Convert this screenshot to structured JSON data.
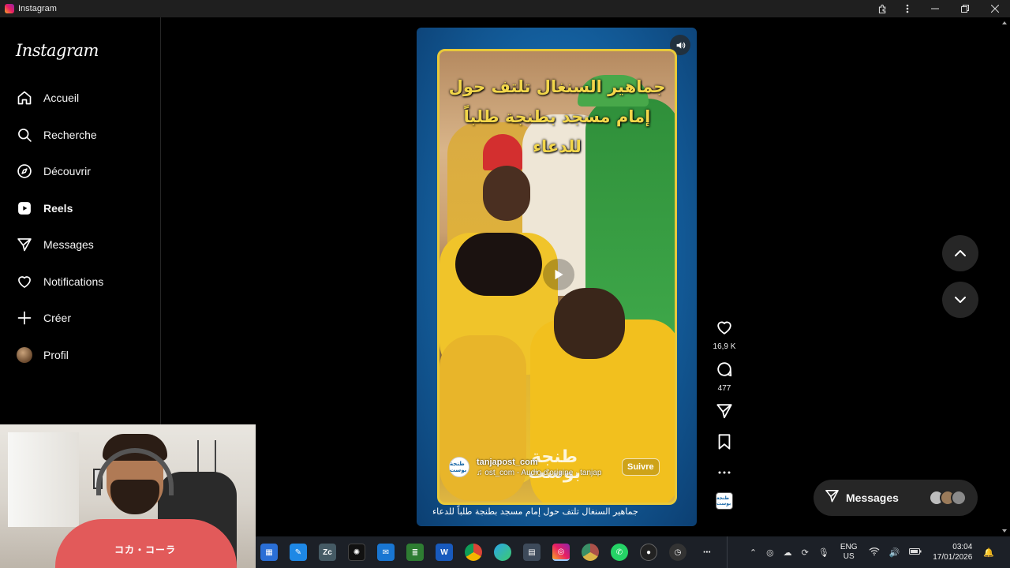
{
  "window": {
    "title": "Instagram"
  },
  "sidebar": {
    "logo": "Instagram",
    "items": [
      {
        "label": "Accueil",
        "icon": "home-icon"
      },
      {
        "label": "Recherche",
        "icon": "search-icon"
      },
      {
        "label": "Découvrir",
        "icon": "compass-icon"
      },
      {
        "label": "Reels",
        "icon": "reels-icon",
        "active": true
      },
      {
        "label": "Messages",
        "icon": "send-icon"
      },
      {
        "label": "Notifications",
        "icon": "heart-icon"
      },
      {
        "label": "Créer",
        "icon": "plus-icon"
      },
      {
        "label": "Profil",
        "icon": "avatar"
      }
    ]
  },
  "reel": {
    "headline_line1": "جماهير السنغال تلتف حول",
    "headline_line2": "إمام مسجد بطنجة طلباً للدعاء",
    "watermark_line1": "طنجة",
    "watermark_line2": "بوست",
    "author": "tanjapost_com",
    "audio": "♫ ost_com - Audio d'origine · tanjap",
    "follow": "Suivre",
    "caption": "جماهير السنغال تلتف حول إمام مسجد بطنجة طلباً للدعاء",
    "likes": "16,9 K",
    "comments": "477",
    "thumb_text": "طنجة بوست"
  },
  "messages_pill": {
    "label": "Messages"
  },
  "webcam": {
    "shirt_text": "コカ・コーラ"
  },
  "taskbar": {
    "lang_line1": "ENG",
    "lang_line2": "US",
    "time": "03:04",
    "date": "17/01/2026"
  },
  "colors": {
    "background": "#000000",
    "reel_frame": "#e8c93a",
    "reel_bg": "#1565a6",
    "headline": "#f2d64a"
  }
}
